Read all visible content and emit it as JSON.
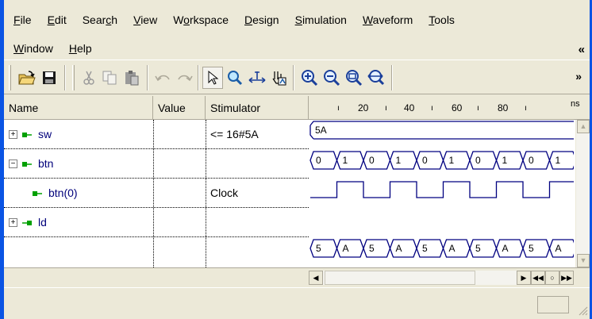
{
  "menu": {
    "row1": [
      {
        "accel": "F",
        "rest": "ile"
      },
      {
        "accel": "E",
        "rest": "dit"
      },
      {
        "pre": "Sear",
        "accel": "c",
        "rest": "h"
      },
      {
        "accel": "V",
        "rest": "iew"
      },
      {
        "pre": "W",
        "accel": "o",
        "rest": "rkspace"
      },
      {
        "accel": "D",
        "rest": "esign"
      },
      {
        "accel": "S",
        "rest": "imulation"
      },
      {
        "accel": "W",
        "rest": "aveform"
      },
      {
        "accel": "T",
        "rest": "ools"
      }
    ],
    "row2": [
      {
        "accel": "W",
        "rest": "indow"
      },
      {
        "accel": "H",
        "rest": "elp"
      }
    ],
    "overflow_glyph": "«"
  },
  "toolbar": {
    "buttons": [
      "open-icon",
      "save-icon",
      "cut-icon",
      "copy-icon",
      "paste-icon",
      "undo-icon",
      "redo-icon",
      "select-pointer-icon",
      "zoom-magnifier-icon",
      "measure-icon",
      "hand-pan-icon",
      "zoom-in-icon",
      "zoom-out-icon",
      "zoom-fit-icon",
      "zoom-full-icon"
    ],
    "overflow_glyph": "»"
  },
  "columns": {
    "name": "Name",
    "value": "Value",
    "stimulator": "Stimulator"
  },
  "ruler": {
    "ticks": [
      "20",
      "40",
      "60",
      "80"
    ],
    "unit": "ns"
  },
  "signals": [
    {
      "name": "sw",
      "value": "",
      "stimulator": "<= 16#5A",
      "expander": "+",
      "kind": "bus-input"
    },
    {
      "name": "btn",
      "value": "",
      "stimulator": "",
      "expander": "−",
      "kind": "bus-input"
    },
    {
      "name": "btn(0)",
      "value": "",
      "stimulator": "Clock",
      "expander": "",
      "kind": "bit-input"
    },
    {
      "name": "ld",
      "value": "",
      "stimulator": "",
      "expander": "+",
      "kind": "bus-output"
    }
  ],
  "waves": {
    "sw_label": "5A",
    "btn_labels": [
      "0",
      "1",
      "0",
      "1",
      "0",
      "1",
      "0",
      "1",
      "0",
      "1"
    ],
    "ld_labels": [
      "5",
      "A",
      "5",
      "A",
      "5",
      "A",
      "5",
      "A",
      "5",
      "A"
    ]
  },
  "colors": {
    "title_frame": "#0a54e4",
    "signal_name": "#00007b",
    "input_arrow": "#00a000",
    "wave_line": "#000080"
  }
}
